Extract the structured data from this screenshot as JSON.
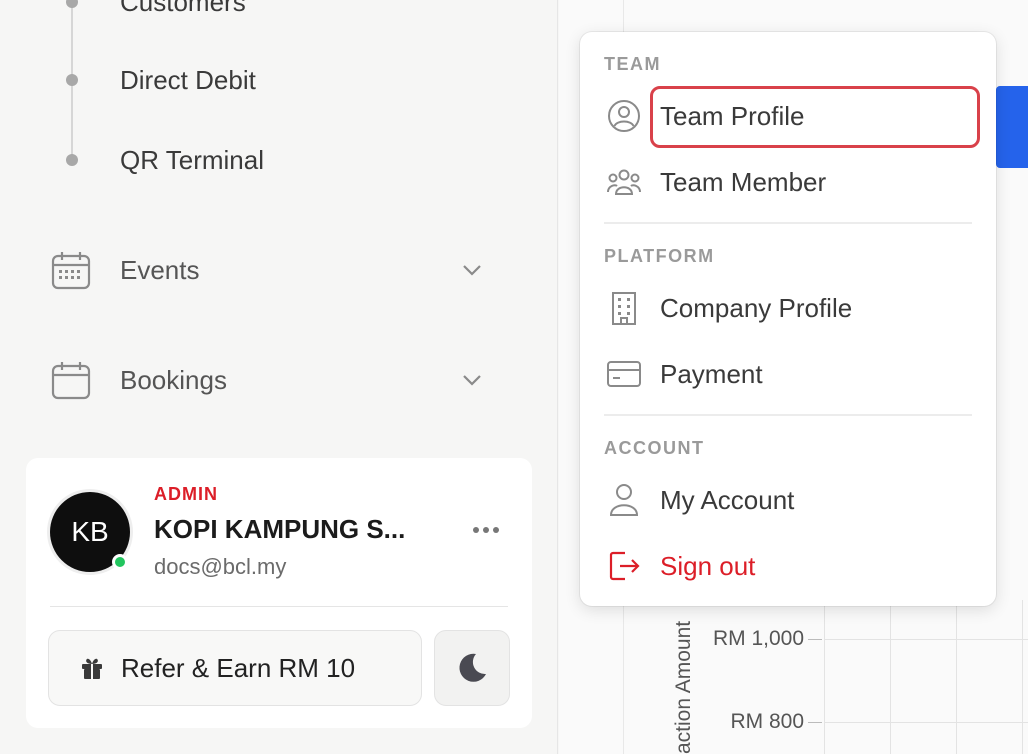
{
  "sidebar": {
    "sub_items": [
      {
        "label": "Customers"
      },
      {
        "label": "Direct Debit"
      },
      {
        "label": "QR Terminal"
      }
    ],
    "nav_items": [
      {
        "label": "Events"
      },
      {
        "label": "Bookings"
      }
    ]
  },
  "profile": {
    "initials": "KB",
    "role": "ADMIN",
    "name": "KOPI KAMPUNG S...",
    "email": "docs@bcl.my",
    "refer_label": "Refer & Earn RM 10"
  },
  "dropdown": {
    "sections": [
      {
        "title": "TEAM",
        "items": [
          {
            "label": "Team Profile",
            "icon": "user-circle-icon"
          },
          {
            "label": "Team Member",
            "icon": "users-group-icon"
          }
        ]
      },
      {
        "title": "PLATFORM",
        "items": [
          {
            "label": "Company Profile",
            "icon": "building-icon"
          },
          {
            "label": "Payment",
            "icon": "credit-card-icon"
          }
        ]
      },
      {
        "title": "ACCOUNT",
        "items": [
          {
            "label": "My Account",
            "icon": "user-icon"
          },
          {
            "label": "Sign out",
            "icon": "sign-out-icon"
          }
        ]
      }
    ]
  },
  "chart": {
    "y_ticks": [
      "RM 1,000",
      "RM 800"
    ],
    "y_label": "action Amount"
  },
  "colors": {
    "accent_red": "#dc1e28",
    "primary_blue": "#2563eb",
    "online_green": "#22c55e"
  }
}
